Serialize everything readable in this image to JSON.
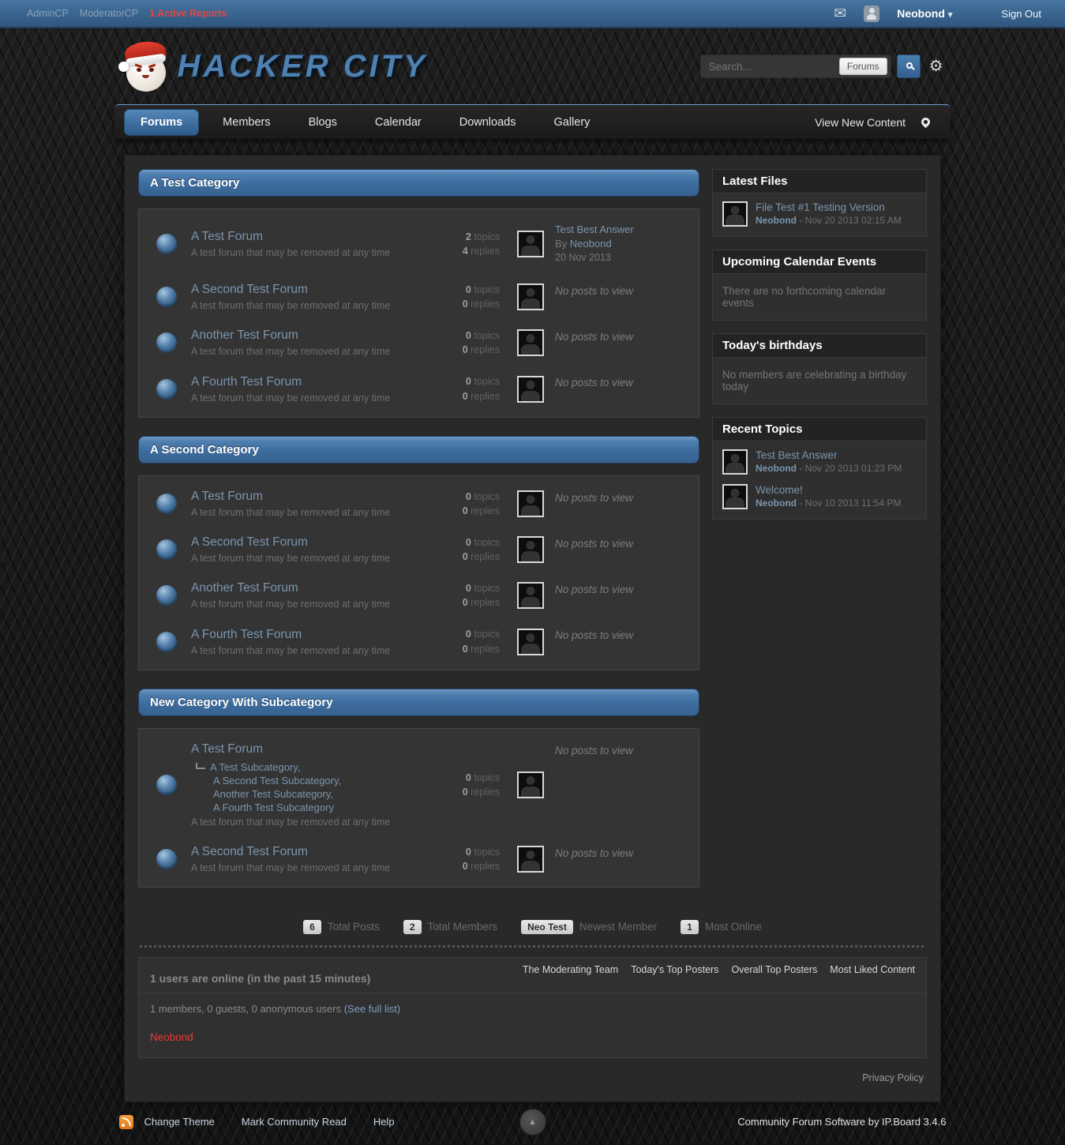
{
  "colors": {
    "accent_blue": "#3c6b9d",
    "link_blue": "#7b95ae",
    "report_red": "#e64545",
    "online_user_red": "#e03b3b",
    "rss_orange": "#f6a13b"
  },
  "icons": {
    "envelope": "✉",
    "gear": "⚙",
    "dropdown_caret": "▾",
    "up_arrow": "▲"
  },
  "topbar": {
    "links": [
      {
        "label": "AdminCP"
      },
      {
        "label": "ModeratorCP"
      },
      {
        "label": "1 Active Reports"
      }
    ],
    "username": "Neobond",
    "sign_out": "Sign Out"
  },
  "header": {
    "site_title": "HACKER CITY",
    "search": {
      "placeholder": "Search...",
      "scope_button": "Forums"
    }
  },
  "nav": {
    "tabs": [
      "Forums",
      "Members",
      "Blogs",
      "Calendar",
      "Downloads",
      "Gallery"
    ],
    "view_new_content": "View New Content"
  },
  "categories": [
    {
      "title": "A Test Category",
      "forums": [
        {
          "name": "A Test Forum",
          "description": "A test forum that may be removed at any time",
          "topics_n": "2",
          "topics_label": "topics",
          "replies_n": "4",
          "replies_label": "replies",
          "last_post": {
            "title": "Test Best Answer",
            "by_label": "By",
            "author": "Neobond",
            "date": "20 Nov 2013"
          }
        },
        {
          "name": "A Second Test Forum",
          "description": "A test forum that may be removed at any time",
          "topics_n": "0",
          "topics_label": "topics",
          "replies_n": "0",
          "replies_label": "replies",
          "no_posts": "No posts to view"
        },
        {
          "name": "Another Test Forum",
          "description": "A test forum that may be removed at any time",
          "topics_n": "0",
          "topics_label": "topics",
          "replies_n": "0",
          "replies_label": "replies",
          "no_posts": "No posts to view"
        },
        {
          "name": "A Fourth Test Forum",
          "description": "A test forum that may be removed at any time",
          "topics_n": "0",
          "topics_label": "topics",
          "replies_n": "0",
          "replies_label": "replies",
          "no_posts": "No posts to view"
        }
      ]
    },
    {
      "title": "A Second Category",
      "forums": [
        {
          "name": "A Test Forum",
          "description": "A test forum that may be removed at any time",
          "topics_n": "0",
          "topics_label": "topics",
          "replies_n": "0",
          "replies_label": "replies",
          "no_posts": "No posts to view"
        },
        {
          "name": "A Second Test Forum",
          "description": "A test forum that may be removed at any time",
          "topics_n": "0",
          "topics_label": "topics",
          "replies_n": "0",
          "replies_label": "replies",
          "no_posts": "No posts to view"
        },
        {
          "name": "Another Test Forum",
          "description": "A test forum that may be removed at any time",
          "topics_n": "0",
          "topics_label": "topics",
          "replies_n": "0",
          "replies_label": "replies",
          "no_posts": "No posts to view"
        },
        {
          "name": "A Fourth Test Forum",
          "description": "A test forum that may be removed at any time",
          "topics_n": "0",
          "topics_label": "topics",
          "replies_n": "0",
          "replies_label": "replies",
          "no_posts": "No posts to view"
        }
      ]
    },
    {
      "title": "New Category With Subcategory",
      "forums": [
        {
          "name": "A Test Forum",
          "description": "A test forum that may be removed at any time",
          "subforums": [
            "A Test Subcategory,",
            "A Second Test Subcategory,",
            "Another Test Subcategory,",
            "A Fourth Test Subcategory"
          ],
          "topics_n": "0",
          "topics_label": "topics",
          "replies_n": "0",
          "replies_label": "replies",
          "no_posts": "No posts to view"
        },
        {
          "name": "A Second Test Forum",
          "description": "A test forum that may be removed at any time",
          "topics_n": "0",
          "topics_label": "topics",
          "replies_n": "0",
          "replies_label": "replies",
          "no_posts": "No posts to view"
        }
      ]
    }
  ],
  "stats": {
    "items": [
      {
        "value": "6",
        "label": "Total Posts"
      },
      {
        "value": "2",
        "label": "Total Members"
      },
      {
        "value": "Neo Test",
        "label": "Newest Member"
      },
      {
        "value": "1",
        "label": "Most Online"
      }
    ]
  },
  "sidebar": {
    "latest_files": {
      "title": "Latest Files",
      "items": [
        {
          "title": "File Test #1 Testing Version",
          "author": "Neobond",
          "date": "- Nov 20 2013 02:15 AM"
        }
      ]
    },
    "calendar": {
      "title": "Upcoming Calendar Events",
      "empty": "There are no forthcoming calendar events"
    },
    "birthdays": {
      "title": "Today's birthdays",
      "empty": "No members are celebrating a birthday today"
    },
    "recent_topics": {
      "title": "Recent Topics",
      "items": [
        {
          "title": "Test Best Answer",
          "author": "Neobond",
          "date": "- Nov 20 2013 01:23 PM"
        },
        {
          "title": "Welcome!",
          "author": "Neobond",
          "date": "- Nov 10 2013 11:54 PM"
        }
      ]
    }
  },
  "footer": {
    "online_title": "1 users are online (in the past 15 minutes)",
    "links": [
      "The Moderating Team",
      "Today's Top Posters",
      "Overall Top Posters",
      "Most Liked Content"
    ],
    "members_line": "1 members, 0 guests, 0 anonymous users",
    "see_full_list": "(See full list)",
    "online_user": "Neobond",
    "privacy": "Privacy Policy",
    "bottom_links": [
      "Change Theme",
      "Mark Community Read",
      "Help"
    ],
    "software": "Community Forum Software by IP.Board 3.4.6"
  }
}
